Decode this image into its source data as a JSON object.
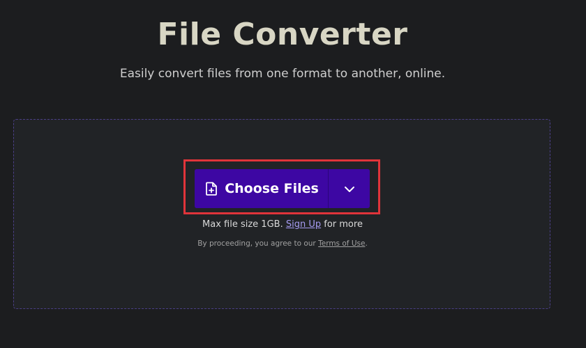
{
  "header": {
    "title": "File Converter",
    "subtitle": "Easily convert files from one format to another, online."
  },
  "upload": {
    "choose_label": "Choose Files",
    "choose_icon": "file-plus-icon",
    "dropdown_icon": "chevron-down-icon",
    "max_size_text": "Max file size 1GB.",
    "sign_up_label": "Sign Up",
    "for_more_text": "for more",
    "terms_prefix": "By proceeding, you agree to our",
    "terms_link": "Terms of Use",
    "terms_suffix": "."
  },
  "colors": {
    "background": "#1c1d1f",
    "dropzone": "#212326",
    "button": "#3d07a3",
    "highlight": "#e0343a",
    "link": "#a69cf2"
  }
}
